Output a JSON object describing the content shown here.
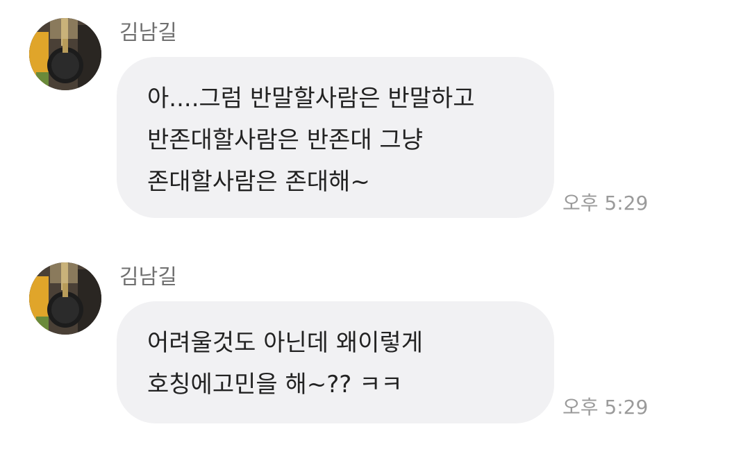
{
  "messages": [
    {
      "sender": "김남길",
      "lines": [
        "아....그럼 반말할사람은 반말하고",
        "반존대할사람은 반존대 그냥",
        "존대할사람은 존대해~"
      ],
      "time": "오후 5:29"
    },
    {
      "sender": "김남길",
      "lines": [
        "어려울것도 아닌데 왜이렇게",
        "호칭에고민을 해~?? ㅋㅋ"
      ],
      "time": "오후 5:29"
    }
  ],
  "colors": {
    "bubble": "#f1f1f3",
    "sender_text": "#707070",
    "time_text": "#9a9a9a",
    "message_text": "#222222"
  },
  "icons": {
    "avatar": "profile-photo-microphone"
  }
}
